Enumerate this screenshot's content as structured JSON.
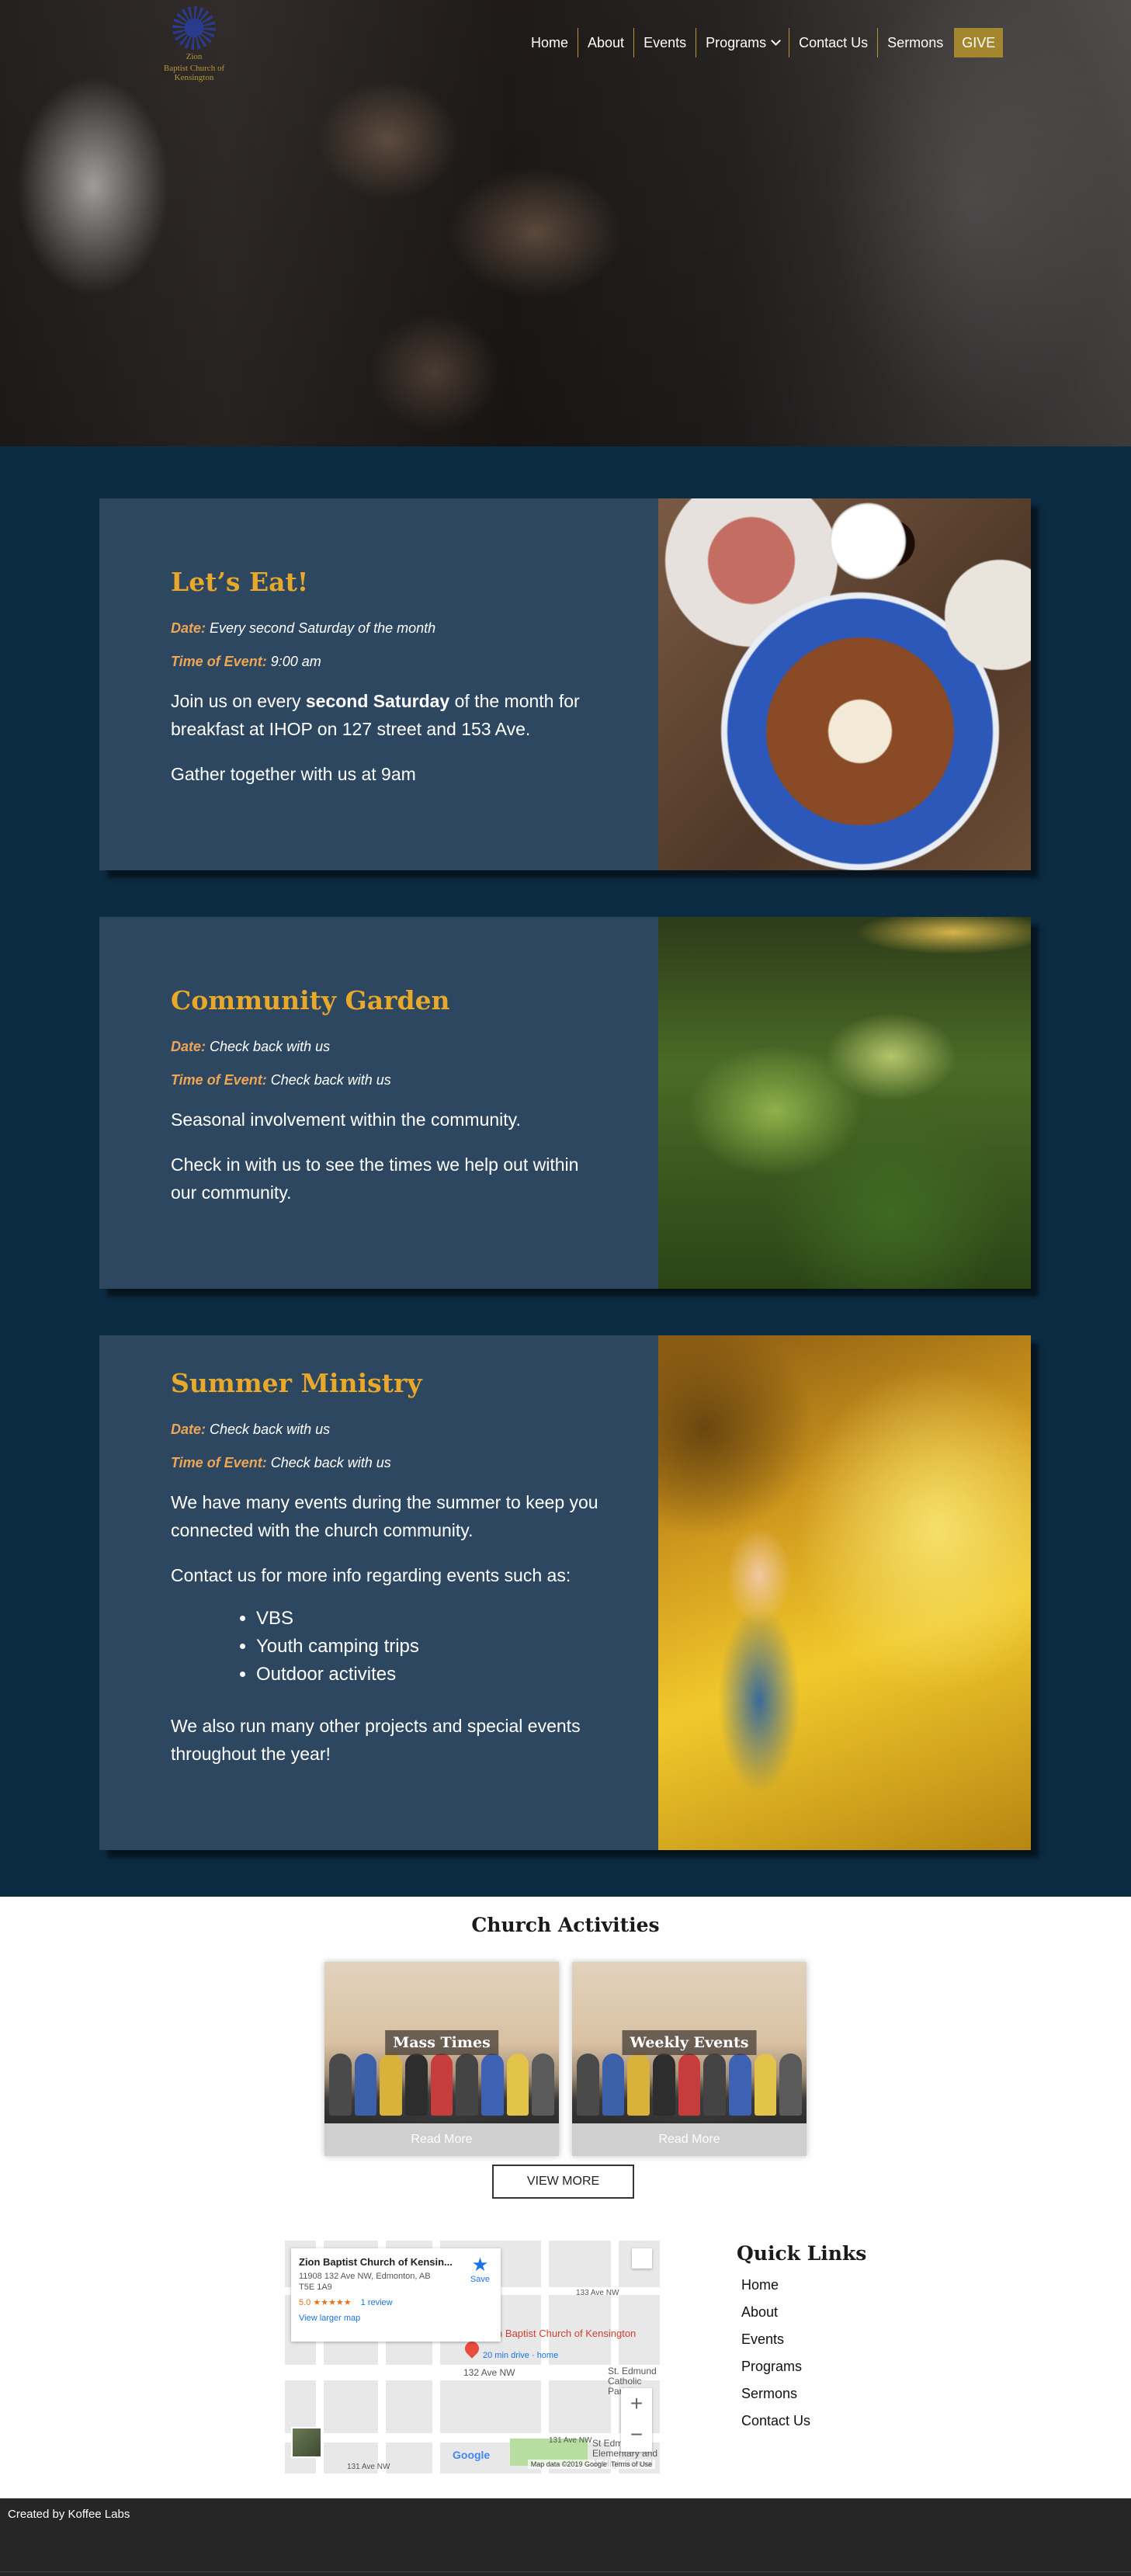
{
  "brand": {
    "name": "Zion",
    "subtitle": "Baptist Church of Kensington"
  },
  "nav": {
    "items": [
      "Home",
      "About",
      "Events",
      "Programs",
      "Contact Us",
      "Sermons"
    ],
    "give_label": "GIVE"
  },
  "events": [
    {
      "title": "Let’s Eat!",
      "date_label": "Date:",
      "date": "Every second Saturday of the month",
      "time_label": "Time of Event:",
      "time": "9:00 am",
      "para1_pre": "Join us on every ",
      "para1_bold": "second Saturday",
      "para1_post": " of the month for breakfast at IHOP on 127 street and 153 Ave.",
      "para2": "Gather together with us at 9am"
    },
    {
      "title": "Community Garden",
      "date_label": "Date:",
      "date": "Check back with us",
      "time_label": "Time of Event:",
      "time": "Check back with us",
      "para1": "Seasonal involvement within the community.",
      "para2": "Check in with us to see the times we help out within our community."
    },
    {
      "title": "Summer Ministry",
      "date_label": "Date:",
      "date": "Check back with us",
      "time_label": "Time of Event:",
      "time": "Check back with us",
      "para1": "We have many events during the summer to keep you connected with the church community.",
      "para2": "Contact us for more info regarding events such as:",
      "list": [
        "VBS",
        "Youth camping trips",
        "Outdoor activites"
      ],
      "para3": "We also run many other projects and special events throughout the year!"
    }
  ],
  "activities": {
    "title": "Church Activities",
    "cards": [
      {
        "label": "Mass Times",
        "more": "Read More"
      },
      {
        "label": "Weekly Events",
        "more": "Read More"
      }
    ],
    "view_more": "VIEW MORE"
  },
  "map": {
    "place_name": "Zion Baptist Church of Kensin...",
    "address": "11908 132 Ave NW, Edmonton, AB T5E 1A9",
    "rating": "5.0 ★★★★★",
    "reviews": "1 review",
    "view_larger": "View larger map",
    "save": "Save",
    "pin_label": "Zion Baptist Church of Kensington",
    "pin_sub": "20 min drive · home",
    "street_1": "132 Ave NW",
    "street_2": "131 Ave NW",
    "street_3": "133 Ave NW",
    "landmark": "St. Edmund Catholic Parish",
    "school": "St Edmund Elementary and Jr High School",
    "attribution": "Map data ©2019 Google",
    "terms": "Terms of Use",
    "google": "Google"
  },
  "quick_links": {
    "title": "Quick Links",
    "items": [
      "Home",
      "About",
      "Events",
      "Programs",
      "Sermons",
      "Contact Us"
    ]
  },
  "footer": {
    "credit": "Created by Koffee Labs"
  },
  "colors": {
    "navy": "#0c2c44",
    "card": "#2e4760",
    "gold_title": "#e8a82a",
    "gold_label": "#eda655",
    "give": "#a3862e"
  }
}
